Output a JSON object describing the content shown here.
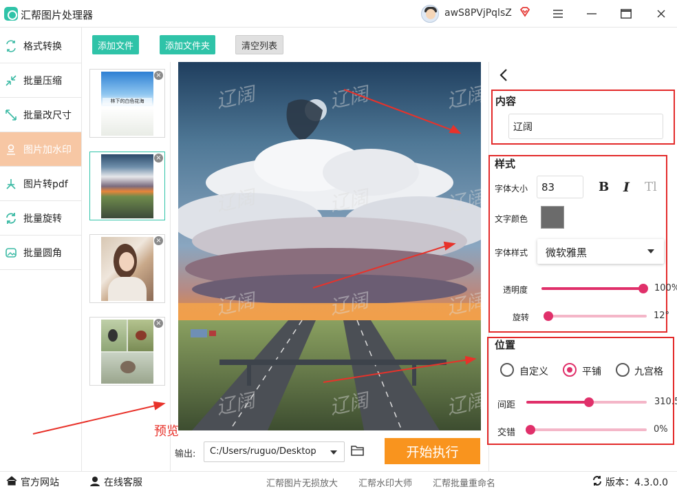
{
  "app": {
    "title": "汇帮图片处理器"
  },
  "user": {
    "name": "awS8PVjPqlsZ"
  },
  "sidebar": {
    "items": [
      {
        "label": "格式转换",
        "icon": "format-convert-icon"
      },
      {
        "label": "批量压缩",
        "icon": "compress-icon"
      },
      {
        "label": "批量改尺寸",
        "icon": "resize-icon"
      },
      {
        "label": "图片加水印",
        "icon": "watermark-icon",
        "active": true
      },
      {
        "label": "图片转pdf",
        "icon": "pdf-icon"
      },
      {
        "label": "批量旋转",
        "icon": "rotate-icon"
      },
      {
        "label": "批量圆角",
        "icon": "round-corner-icon"
      }
    ]
  },
  "toolbar": {
    "add_file": "添加文件",
    "add_folder": "添加文件夹",
    "clear_list": "清空列表"
  },
  "thumbnails": [
    {
      "caption": "林下的白色花海",
      "selected": false
    },
    {
      "caption": "",
      "selected": true
    },
    {
      "caption": "",
      "selected": false
    },
    {
      "caption": "",
      "selected": false
    }
  ],
  "preview": {
    "watermark_text": "辽阔",
    "annotation": "预览"
  },
  "output": {
    "label": "输出:",
    "path": "C:/Users/ruguo/Desktop"
  },
  "start_button": "开始执行",
  "panel": {
    "content": {
      "title": "内容",
      "text_value": "辽阔"
    },
    "style": {
      "title": "样式",
      "font_size_label": "字体大小",
      "font_size_value": "83",
      "bold_label": "B",
      "italic_label": "I",
      "strike_label": "Tl",
      "color_label": "文字颜色",
      "color_value": "#6b6b6b",
      "font_style_label": "字体样式",
      "font_style_value": "微软雅黑",
      "opacity_label": "透明度",
      "opacity_value": "100%",
      "opacity_level": 1.0,
      "rotate_label": "旋转",
      "rotate_value": "12°",
      "rotate_level": 0.03
    },
    "position": {
      "title": "位置",
      "options": [
        {
          "label": "自定义",
          "checked": false
        },
        {
          "label": "平铺",
          "checked": true
        },
        {
          "label": "九宫格",
          "checked": false
        }
      ],
      "spacing_label": "间距",
      "spacing_value": "310.5",
      "spacing_level": 0.52,
      "stagger_label": "交错",
      "stagger_value": "0%",
      "stagger_level": 0.0
    }
  },
  "footer": {
    "official_site": "官方网站",
    "online_support": "在线客服",
    "links": [
      "汇帮图片无损放大",
      "汇帮水印大师",
      "汇帮批量重命名"
    ],
    "version": "版本：4.3.0.0"
  },
  "colors": {
    "accent": "#2fc3a8",
    "active_item": "#f7c7a4",
    "slider": "#e0306a",
    "start": "#f9941e",
    "annotation": "#e8322a"
  }
}
